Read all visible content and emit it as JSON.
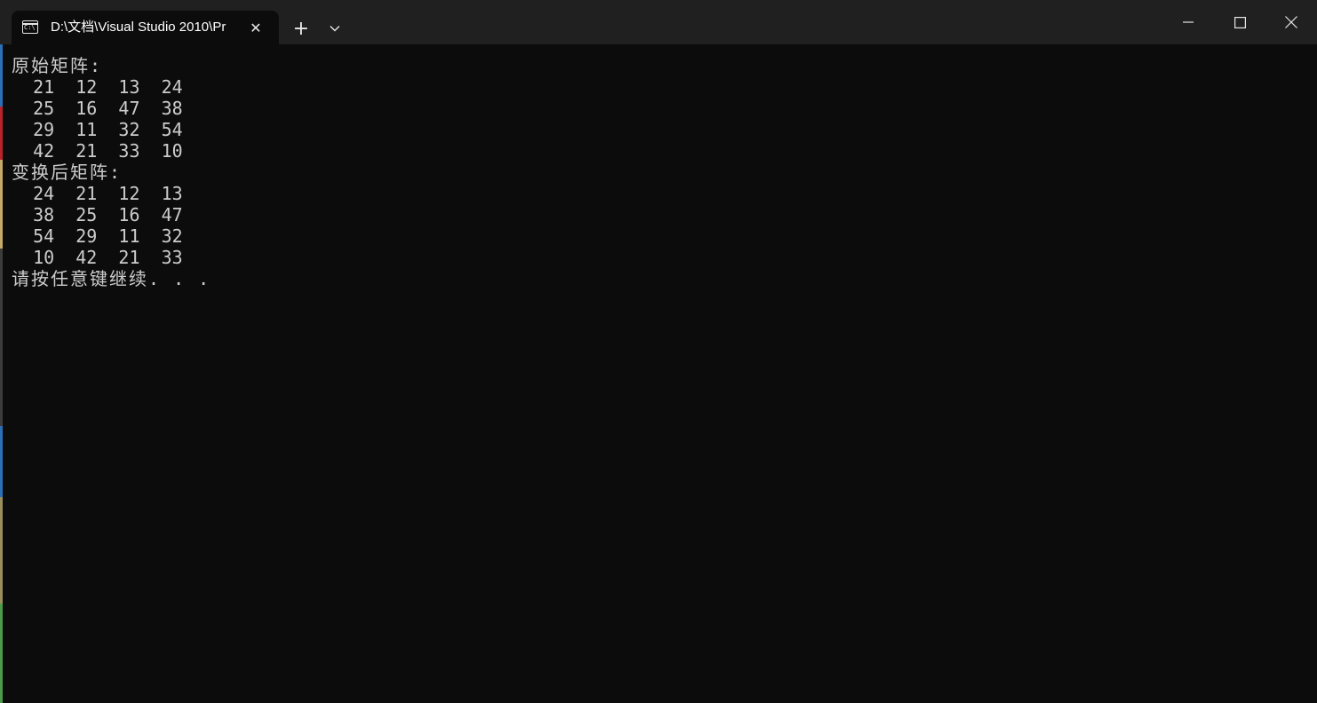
{
  "window": {
    "tab_title": "D:\\文档\\Visual Studio 2010\\Pr",
    "tab_icon": "terminal-icon",
    "tab_icon_glyph": "C:\\",
    "new_tab_label": "+",
    "close_tab_label": "✕"
  },
  "terminal": {
    "lines": [
      "原始矩阵:",
      "  21  12  13  24",
      "  25  16  47  38",
      "  29  11  32  54",
      "  42  21  33  10",
      "变换后矩阵:",
      "  24  21  12  13",
      "  38  25  16  47",
      "  54  29  11  32",
      "  10  42  21  33",
      "请按任意键继续. . ."
    ]
  },
  "colors": {
    "titlebar": "#202020",
    "background": "#0c0c0c",
    "text": "#cccccc"
  }
}
